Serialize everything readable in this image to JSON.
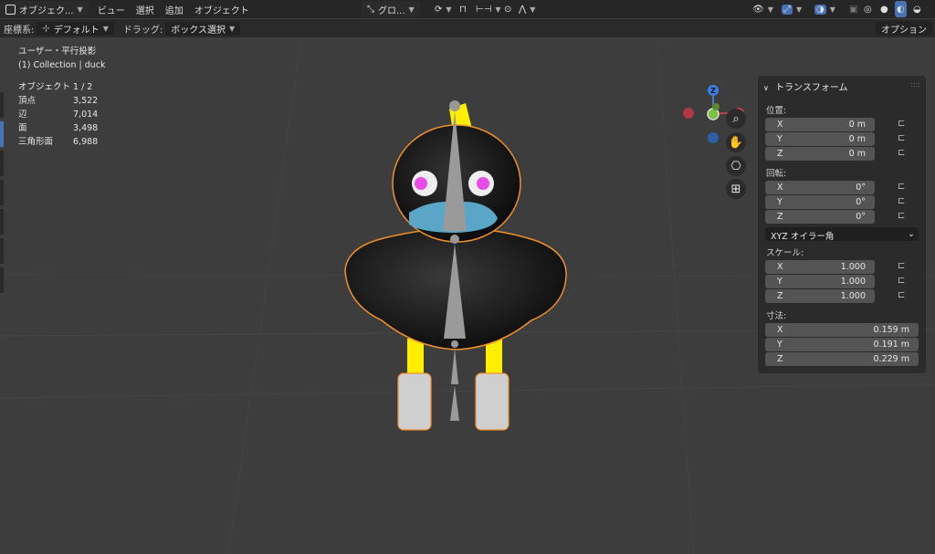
{
  "topbar": {
    "mode": "オブジェク...",
    "menus": [
      "ビュー",
      "選択",
      "追加",
      "オブジェクト"
    ],
    "transform_orientation": "グロ..."
  },
  "secbar": {
    "orientation_label": "座標系:",
    "orientation_value": "デフォルト",
    "drag_label": "ドラッグ:",
    "drag_value": "ボックス選択",
    "options": "オプション"
  },
  "overlay": {
    "view_name": "ユーザー・平行投影",
    "collection": "(1) Collection | duck",
    "stats": [
      {
        "k": "オブジェクト",
        "v": "1 / 2"
      },
      {
        "k": "頂点",
        "v": "3,522"
      },
      {
        "k": "辺",
        "v": "7,014"
      },
      {
        "k": "面",
        "v": "3,498"
      },
      {
        "k": "三角形面",
        "v": "6,988"
      }
    ]
  },
  "gizmo": {
    "z": "Z",
    "x": "X"
  },
  "panel": {
    "title": "トランスフォーム",
    "location_label": "位置:",
    "location": [
      {
        "ax": "X",
        "v": "0 m"
      },
      {
        "ax": "Y",
        "v": "0 m"
      },
      {
        "ax": "Z",
        "v": "0 m"
      }
    ],
    "rotation_label": "回転:",
    "rotation": [
      {
        "ax": "X",
        "v": "0°"
      },
      {
        "ax": "Y",
        "v": "0°"
      },
      {
        "ax": "Z",
        "v": "0°"
      }
    ],
    "rotation_mode": "XYZ オイラー角",
    "scale_label": "スケール:",
    "scale": [
      {
        "ax": "X",
        "v": "1.000"
      },
      {
        "ax": "Y",
        "v": "1.000"
      },
      {
        "ax": "Z",
        "v": "1.000"
      }
    ],
    "dimensions_label": "寸法:",
    "dimensions": [
      {
        "ax": "X",
        "v": "0.159 m"
      },
      {
        "ax": "Y",
        "v": "0.191 m"
      },
      {
        "ax": "Z",
        "v": "0.229 m"
      }
    ]
  },
  "colors": {
    "accent": "#4772b3",
    "selection": "#f0902b",
    "beak": "#5aa6c9",
    "eye": "#e64ee6",
    "legs": "#ffee00"
  }
}
